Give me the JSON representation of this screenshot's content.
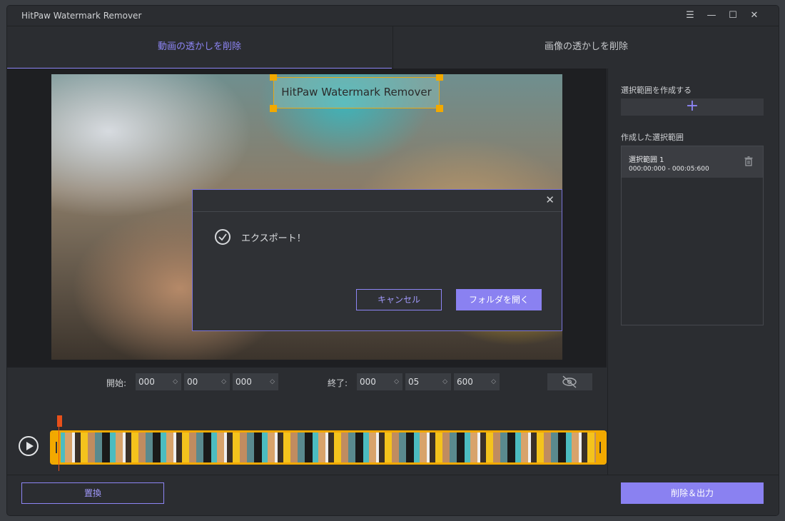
{
  "app": {
    "title": "HitPaw Watermark Remover"
  },
  "window_controls": {
    "menu": "☰",
    "minimize": "—",
    "maximize": "☐",
    "close": "✕"
  },
  "tabs": [
    {
      "label": "動画の透かしを削除",
      "active": true
    },
    {
      "label": "画像の透かしを削除",
      "active": false
    }
  ],
  "video": {
    "watermark_text": "HitPaw Watermark Remover"
  },
  "dialog": {
    "close": "✕",
    "message": "エクスポート！",
    "cancel_label": "キャンセル",
    "open_folder_label": "フォルダを開く"
  },
  "time": {
    "start_label": "開始:",
    "start_values": [
      "000",
      "00",
      "000"
    ],
    "end_label": "終了:",
    "end_values": [
      "000",
      "05",
      "600"
    ],
    "arrow": "◇"
  },
  "right_panel": {
    "create_label": "選択範囲を作成する",
    "add_symbol": "+",
    "created_label": "作成した選択範囲",
    "selections": [
      {
        "name": "選択範囲 1",
        "range": "000:00:000 - 000:05:600"
      }
    ]
  },
  "bottom": {
    "replace_label": "置換",
    "export_label": "削除＆出力"
  },
  "colors": {
    "accent": "#8a81f1",
    "handle": "#f2a900",
    "playhead": "#e8501a"
  }
}
